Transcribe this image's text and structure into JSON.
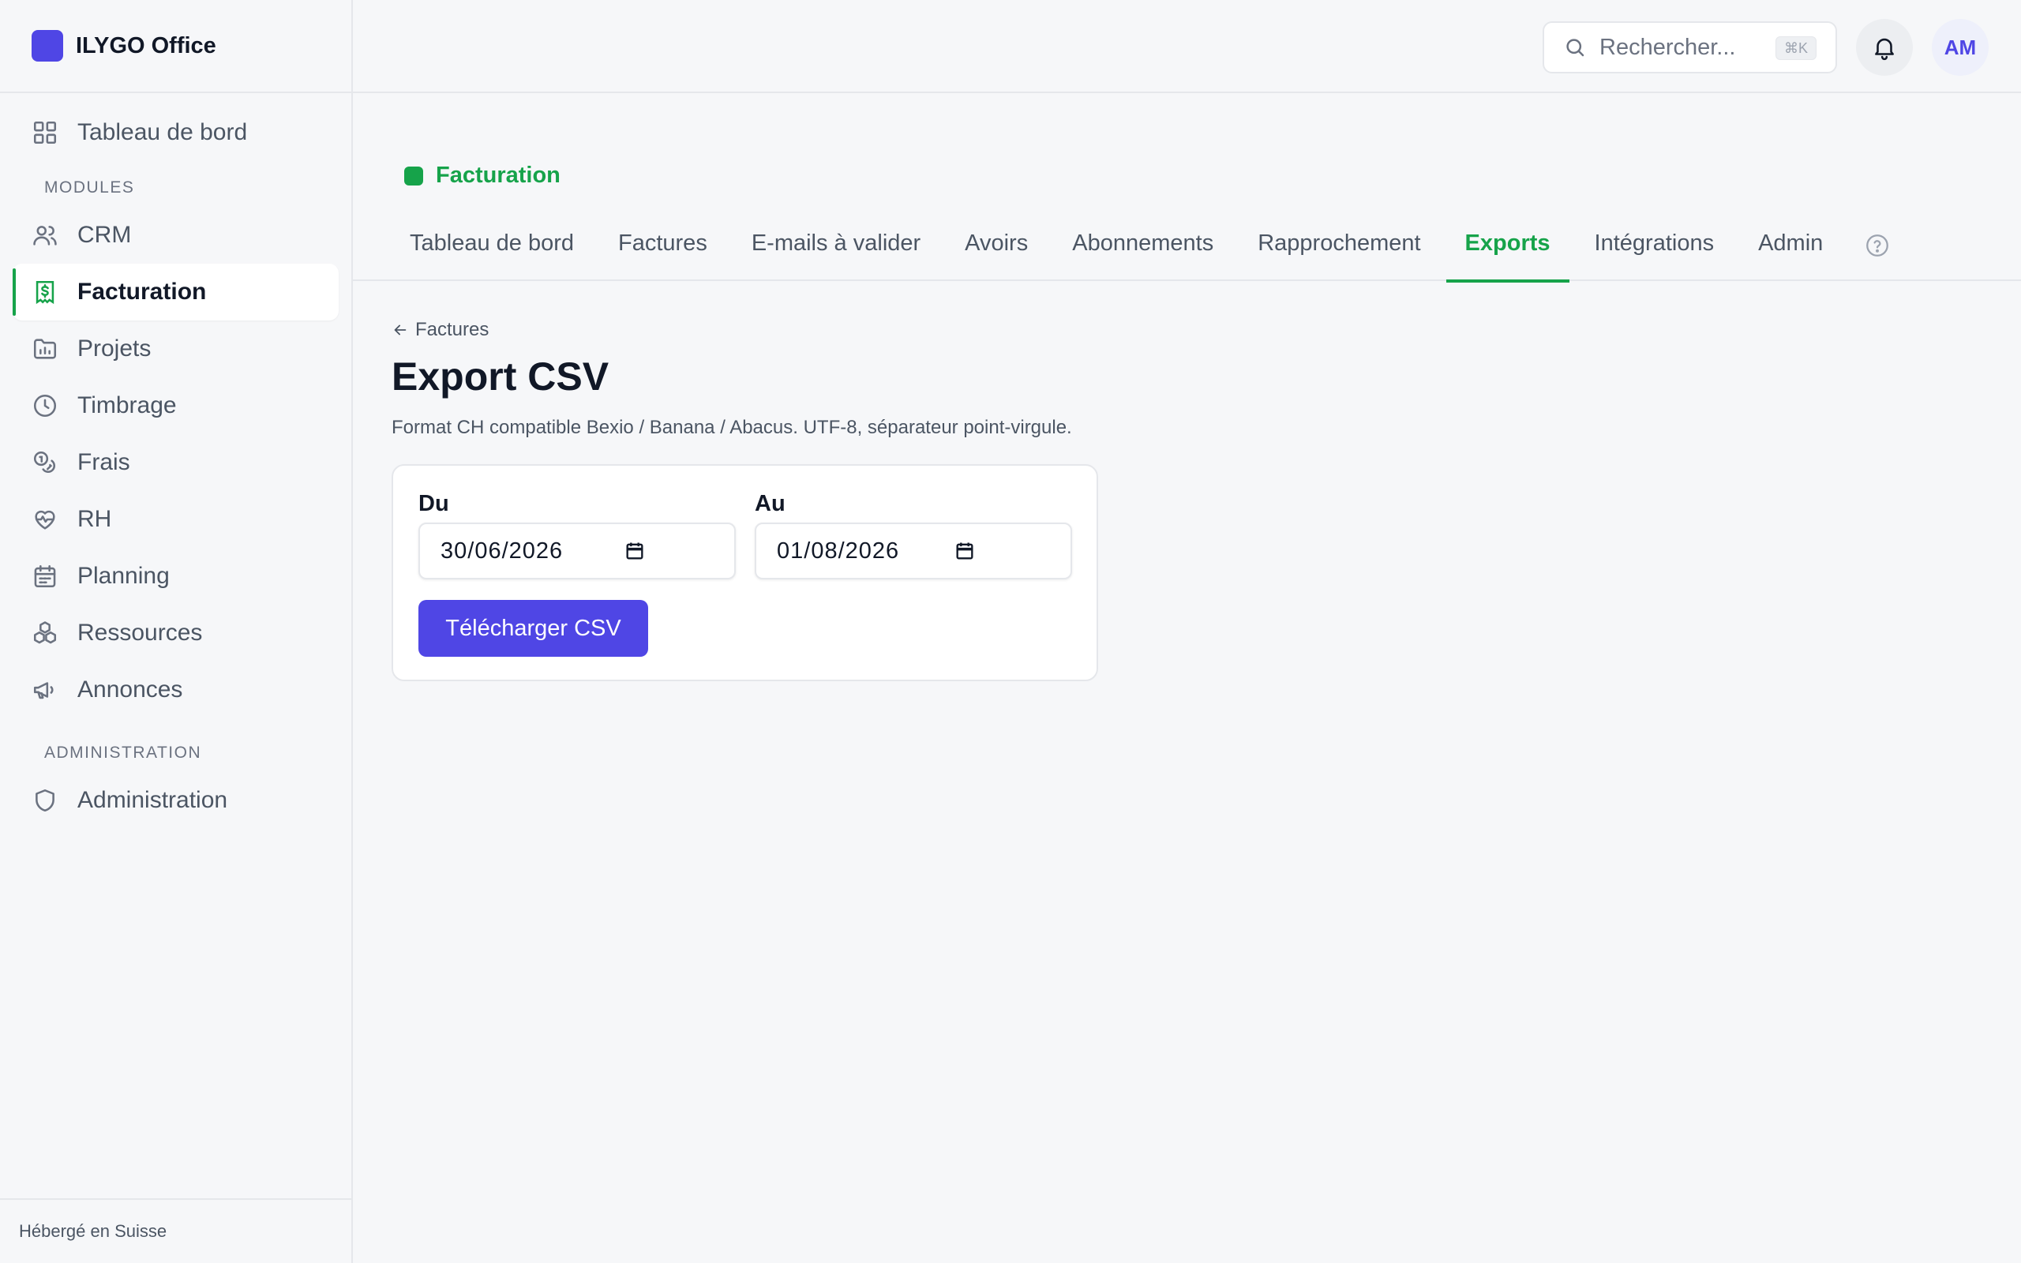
{
  "app": {
    "name": "ILYGO Office"
  },
  "sidebar": {
    "top_item": {
      "label": "Tableau de bord",
      "icon": "grid-icon"
    },
    "modules_label": "MODULES",
    "modules": [
      {
        "label": "CRM",
        "icon": "users-icon"
      },
      {
        "label": "Facturation",
        "icon": "receipt-icon",
        "active": true
      },
      {
        "label": "Projets",
        "icon": "folder-chart-icon"
      },
      {
        "label": "Timbrage",
        "icon": "clock-icon"
      },
      {
        "label": "Frais",
        "icon": "coins-icon"
      },
      {
        "label": "RH",
        "icon": "heart-pulse-icon"
      },
      {
        "label": "Planning",
        "icon": "calendar-icon"
      },
      {
        "label": "Ressources",
        "icon": "boxes-icon"
      },
      {
        "label": "Annonces",
        "icon": "megaphone-icon"
      }
    ],
    "admin_label": "ADMINISTRATION",
    "admin_items": [
      {
        "label": "Administration",
        "icon": "shield-icon"
      }
    ],
    "footer": "Hébergé en Suisse"
  },
  "topbar": {
    "search_placeholder": "Rechercher...",
    "search_shortcut": "⌘K",
    "avatar_initials": "AM"
  },
  "module": {
    "name": "Facturation",
    "color": "#16a34a",
    "tabs": [
      {
        "label": "Tableau de bord"
      },
      {
        "label": "Factures"
      },
      {
        "label": "E-mails à valider"
      },
      {
        "label": "Avoirs"
      },
      {
        "label": "Abonnements"
      },
      {
        "label": "Rapprochement"
      },
      {
        "label": "Exports",
        "active": true
      },
      {
        "label": "Intégrations"
      },
      {
        "label": "Admin"
      }
    ]
  },
  "page": {
    "back_label": "Factures",
    "title": "Export CSV",
    "description": "Format CH compatible Bexio / Banana / Abacus. UTF-8, séparateur point-virgule.",
    "from_label": "Du",
    "from_value": "30/06/2026",
    "to_label": "Au",
    "to_value": "01/08/2026",
    "download_label": "Télécharger CSV"
  },
  "colors": {
    "accent": "#4f46e5",
    "module": "#16a34a"
  }
}
